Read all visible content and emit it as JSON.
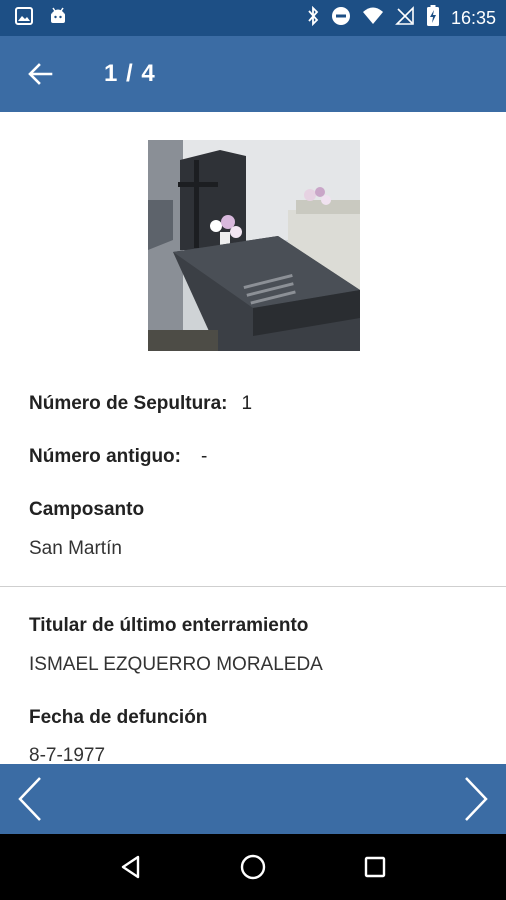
{
  "status_bar": {
    "time": "16:35",
    "icons_left": [
      "image-icon",
      "android-icon"
    ],
    "icons_right": [
      "bluetooth-icon",
      "do-not-disturb-icon",
      "wifi-icon",
      "no-sim-icon",
      "battery-charging-icon"
    ]
  },
  "app_bar": {
    "title": "1 / 4"
  },
  "record": {
    "numero_sepultura": {
      "label": "Número de Sepultura:",
      "value": "1"
    },
    "numero_antiguo": {
      "label": "Número antiguo:",
      "value": "-"
    },
    "camposanto": {
      "label": "Camposanto",
      "value": "San Martín"
    },
    "titular": {
      "label": "Titular de último enterramiento",
      "value": "ISMAEL EZQUERRO MORALEDA"
    },
    "fecha_defuncion": {
      "label": "Fecha de defunción",
      "value": "8-7-1977"
    }
  },
  "colors": {
    "status_bar": "#1d4f85",
    "app_bar": "#3b6ca4",
    "pager_bar": "#3b6ca4",
    "nav_bar": "#000000"
  }
}
